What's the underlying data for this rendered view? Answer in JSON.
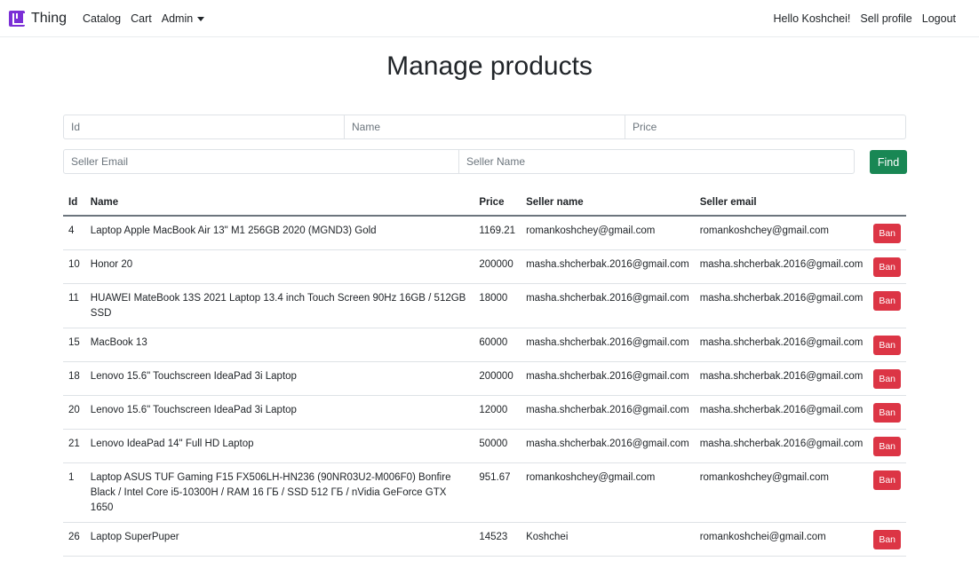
{
  "navbar": {
    "brand": "Thing",
    "links": [
      "Catalog",
      "Cart",
      "Admin"
    ],
    "right_links": [
      "Hello Koshchei!",
      "Sell profile",
      "Logout"
    ],
    "logo_color": "#7b2fd6"
  },
  "page": {
    "title": "Manage products"
  },
  "filters": {
    "id_placeholder": "Id",
    "name_placeholder": "Name",
    "price_placeholder": "Price",
    "seller_email_placeholder": "Seller Email",
    "seller_name_placeholder": "Seller Name",
    "find_label": "Find",
    "find_color": "#198754"
  },
  "table": {
    "headers": [
      "Id",
      "Name",
      "Price",
      "Seller name",
      "Seller email"
    ],
    "ban_label": "Ban",
    "ban_color": "#dc3545",
    "rows": [
      {
        "id": "4",
        "name": "Laptop Apple MacBook Air 13\" M1 256GB 2020 (MGND3) Gold",
        "price": "1169.21",
        "seller": "romankoshchey@gmail.com",
        "email": "romankoshchey@gmail.com"
      },
      {
        "id": "10",
        "name": "Honor 20",
        "price": "200000",
        "seller": "masha.shcherbak.2016@gmail.com",
        "email": "masha.shcherbak.2016@gmail.com"
      },
      {
        "id": "11",
        "name": "HUAWEI MateBook 13S 2021 Laptop 13.4 inch Touch Screen 90Hz 16GB / 512GB SSD",
        "price": "18000",
        "seller": "masha.shcherbak.2016@gmail.com",
        "email": "masha.shcherbak.2016@gmail.com"
      },
      {
        "id": "15",
        "name": "MacBook 13",
        "price": "60000",
        "seller": "masha.shcherbak.2016@gmail.com",
        "email": "masha.shcherbak.2016@gmail.com"
      },
      {
        "id": "18",
        "name": "Lenovo 15.6\" Touchscreen IdeaPad 3i Laptop",
        "price": "200000",
        "seller": "masha.shcherbak.2016@gmail.com",
        "email": "masha.shcherbak.2016@gmail.com"
      },
      {
        "id": "20",
        "name": "Lenovo 15.6\" Touchscreen IdeaPad 3i Laptop",
        "price": "12000",
        "seller": "masha.shcherbak.2016@gmail.com",
        "email": "masha.shcherbak.2016@gmail.com"
      },
      {
        "id": "21",
        "name": "Lenovo IdeaPad 14\" Full HD Laptop",
        "price": "50000",
        "seller": "masha.shcherbak.2016@gmail.com",
        "email": "masha.shcherbak.2016@gmail.com"
      },
      {
        "id": "1",
        "name": "Laptop ASUS TUF Gaming F15 FX506LH-HN236 (90NR03U2-M006F0) Bonfire Black / Intel Core i5-10300H / RAM 16 ГБ / SSD 512 ГБ / nVidia GeForce GTX 1650",
        "price": "951.67",
        "seller": "romankoshchey@gmail.com",
        "email": "romankoshchey@gmail.com"
      },
      {
        "id": "26",
        "name": "Laptop SuperPuper",
        "price": "14523",
        "seller": "Koshchei",
        "email": "romankoshchei@gmail.com"
      }
    ]
  }
}
